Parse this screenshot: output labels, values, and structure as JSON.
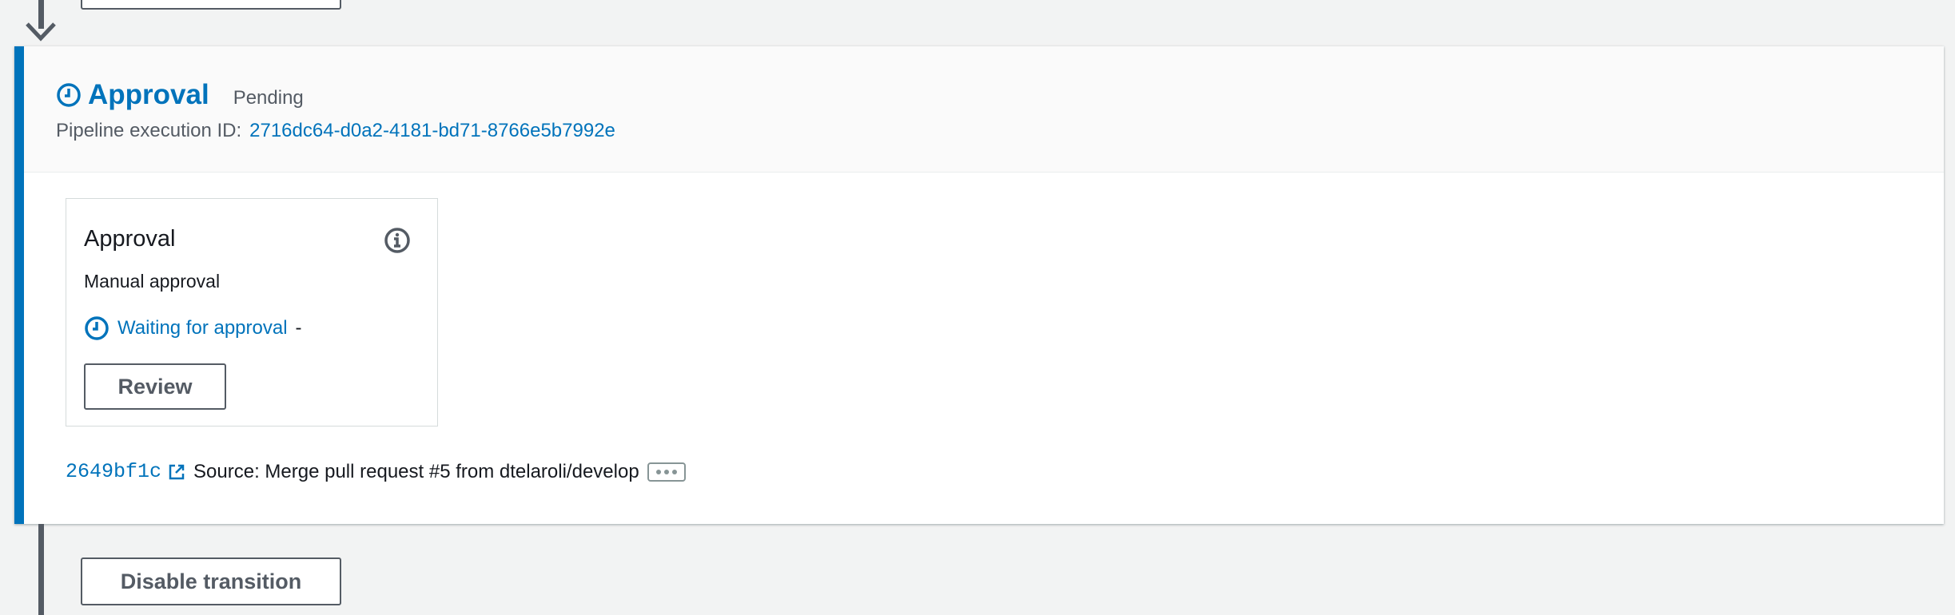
{
  "stage": {
    "title": "Approval",
    "status": "Pending",
    "execution_id_label": "Pipeline execution ID:",
    "execution_id": "2716dc64-d0a2-4181-bd71-8766e5b7992e"
  },
  "action": {
    "title": "Approval",
    "subtitle": "Manual approval",
    "status": "Waiting for approval",
    "status_suffix": "-",
    "review_label": "Review"
  },
  "source": {
    "commit": "2649bf1c",
    "message": "Source: Merge pull request #5 from dtelaroli/develop"
  },
  "transition": {
    "button_label": "Disable transition"
  },
  "colors": {
    "accent": "#0073bb",
    "text": "#16191f",
    "muted": "#545b64",
    "background": "#f2f3f3"
  },
  "icons": [
    "clock-icon",
    "info-icon",
    "external-link-icon",
    "ellipsis-icon",
    "arrow-down-icon"
  ]
}
